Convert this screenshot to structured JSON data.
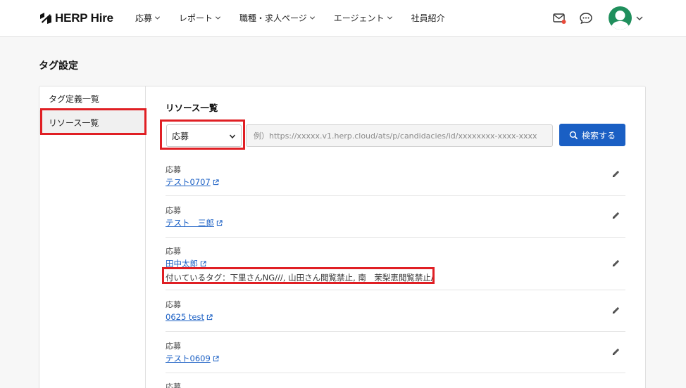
{
  "header": {
    "logo": "HERP Hire",
    "nav": [
      "応募",
      "レポート",
      "職種・求人ページ",
      "エージェント",
      "社員紹介"
    ],
    "nav_has_chevron": [
      true,
      true,
      true,
      true,
      false
    ],
    "colors": {
      "avatar": "#1f8f5c",
      "mail_badge": "#e84b3a"
    }
  },
  "page": {
    "title": "タグ設定"
  },
  "sidebar": {
    "items": [
      "タグ定義一覧",
      "リソース一覧"
    ],
    "selected": "リソース一覧"
  },
  "main": {
    "section_title": "リソース一覧",
    "filter": {
      "select_value": "応募",
      "url_placeholder": "例）https://xxxxx.v1.herp.cloud/ats/p/candidacies/id/xxxxxxxx-xxxx-xxxx",
      "search_label": "検索する"
    },
    "rows": [
      {
        "type": "応募",
        "link": "テスト0707",
        "tags": ""
      },
      {
        "type": "応募",
        "link": "テスト　三郎",
        "tags": ""
      },
      {
        "type": "応募",
        "link": "田中太郎",
        "tags": "付いているタグ：下里さんNG///, 山田さん閲覧禁止, 南　茉梨恵閲覧禁止/"
      },
      {
        "type": "応募",
        "link": "0625 test",
        "tags": ""
      },
      {
        "type": "応募",
        "link": "テスト0609",
        "tags": ""
      },
      {
        "type": "応募",
        "link": "",
        "tags": ""
      }
    ]
  },
  "colors": {
    "accent": "#1a5fc4",
    "highlight": "#e01f24"
  }
}
